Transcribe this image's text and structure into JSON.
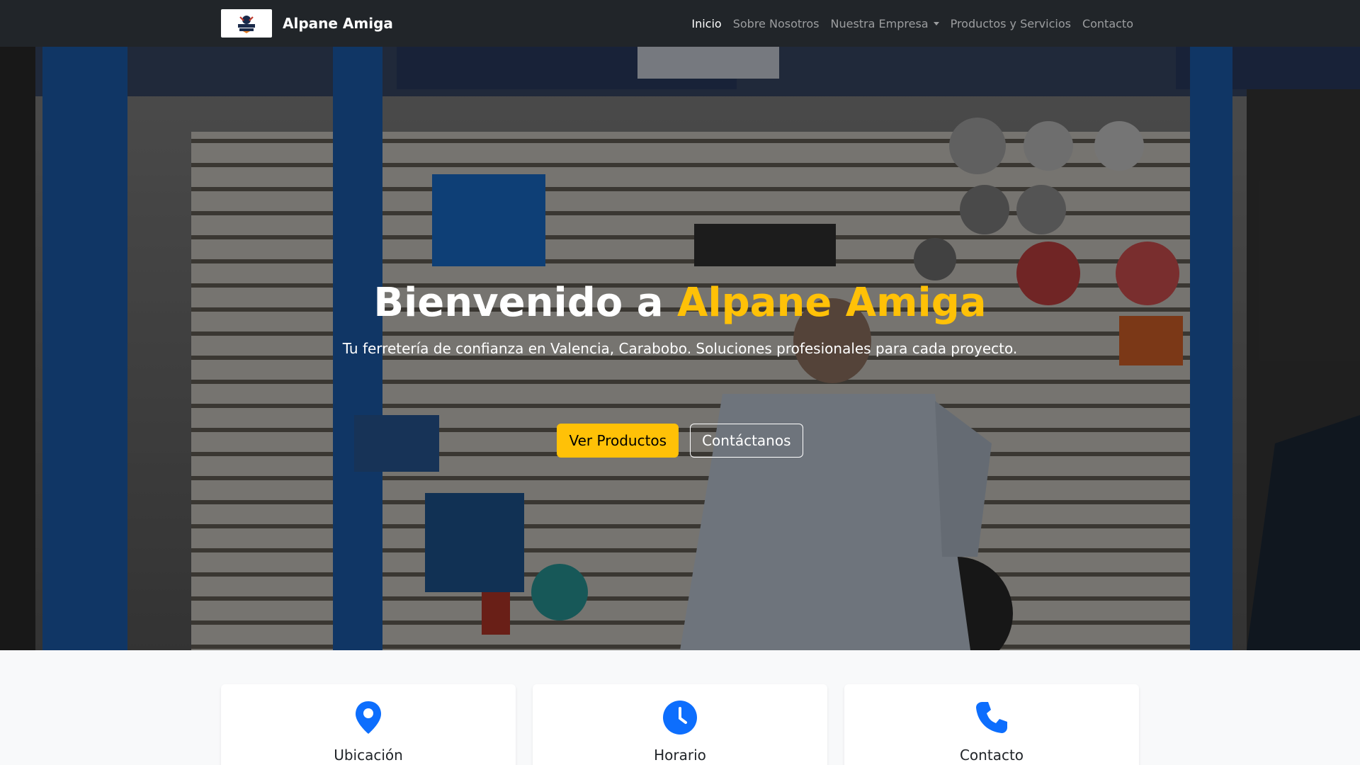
{
  "brand": {
    "name": "Alpane Amiga",
    "logo_text": "ALPANE AMIGA"
  },
  "nav": {
    "items": [
      {
        "label": "Inicio",
        "active": true
      },
      {
        "label": "Sobre Nosotros"
      },
      {
        "label": "Nuestra Empresa",
        "dropdown": true
      },
      {
        "label": "Productos y Servicios"
      },
      {
        "label": "Contacto"
      }
    ]
  },
  "hero": {
    "title_prefix": "Bienvenido a ",
    "title_accent": "Alpane Amiga",
    "subtitle": "Tu ferretería de confianza en Valencia, Carabobo. Soluciones profesionales para cada proyecto.",
    "primary_button": "Ver Productos",
    "secondary_button": "Contáctanos",
    "background": "hardware-store-photo"
  },
  "info_cards": [
    {
      "title": "Ubicación",
      "icon": "map-pin-icon"
    },
    {
      "title": "Horario",
      "icon": "clock-icon"
    },
    {
      "title": "Contacto",
      "icon": "phone-icon"
    }
  ],
  "colors": {
    "navbar": "#212529",
    "accent": "#ffc107",
    "icon_blue": "#0d6efd",
    "section_bg": "#f8f9fa"
  }
}
